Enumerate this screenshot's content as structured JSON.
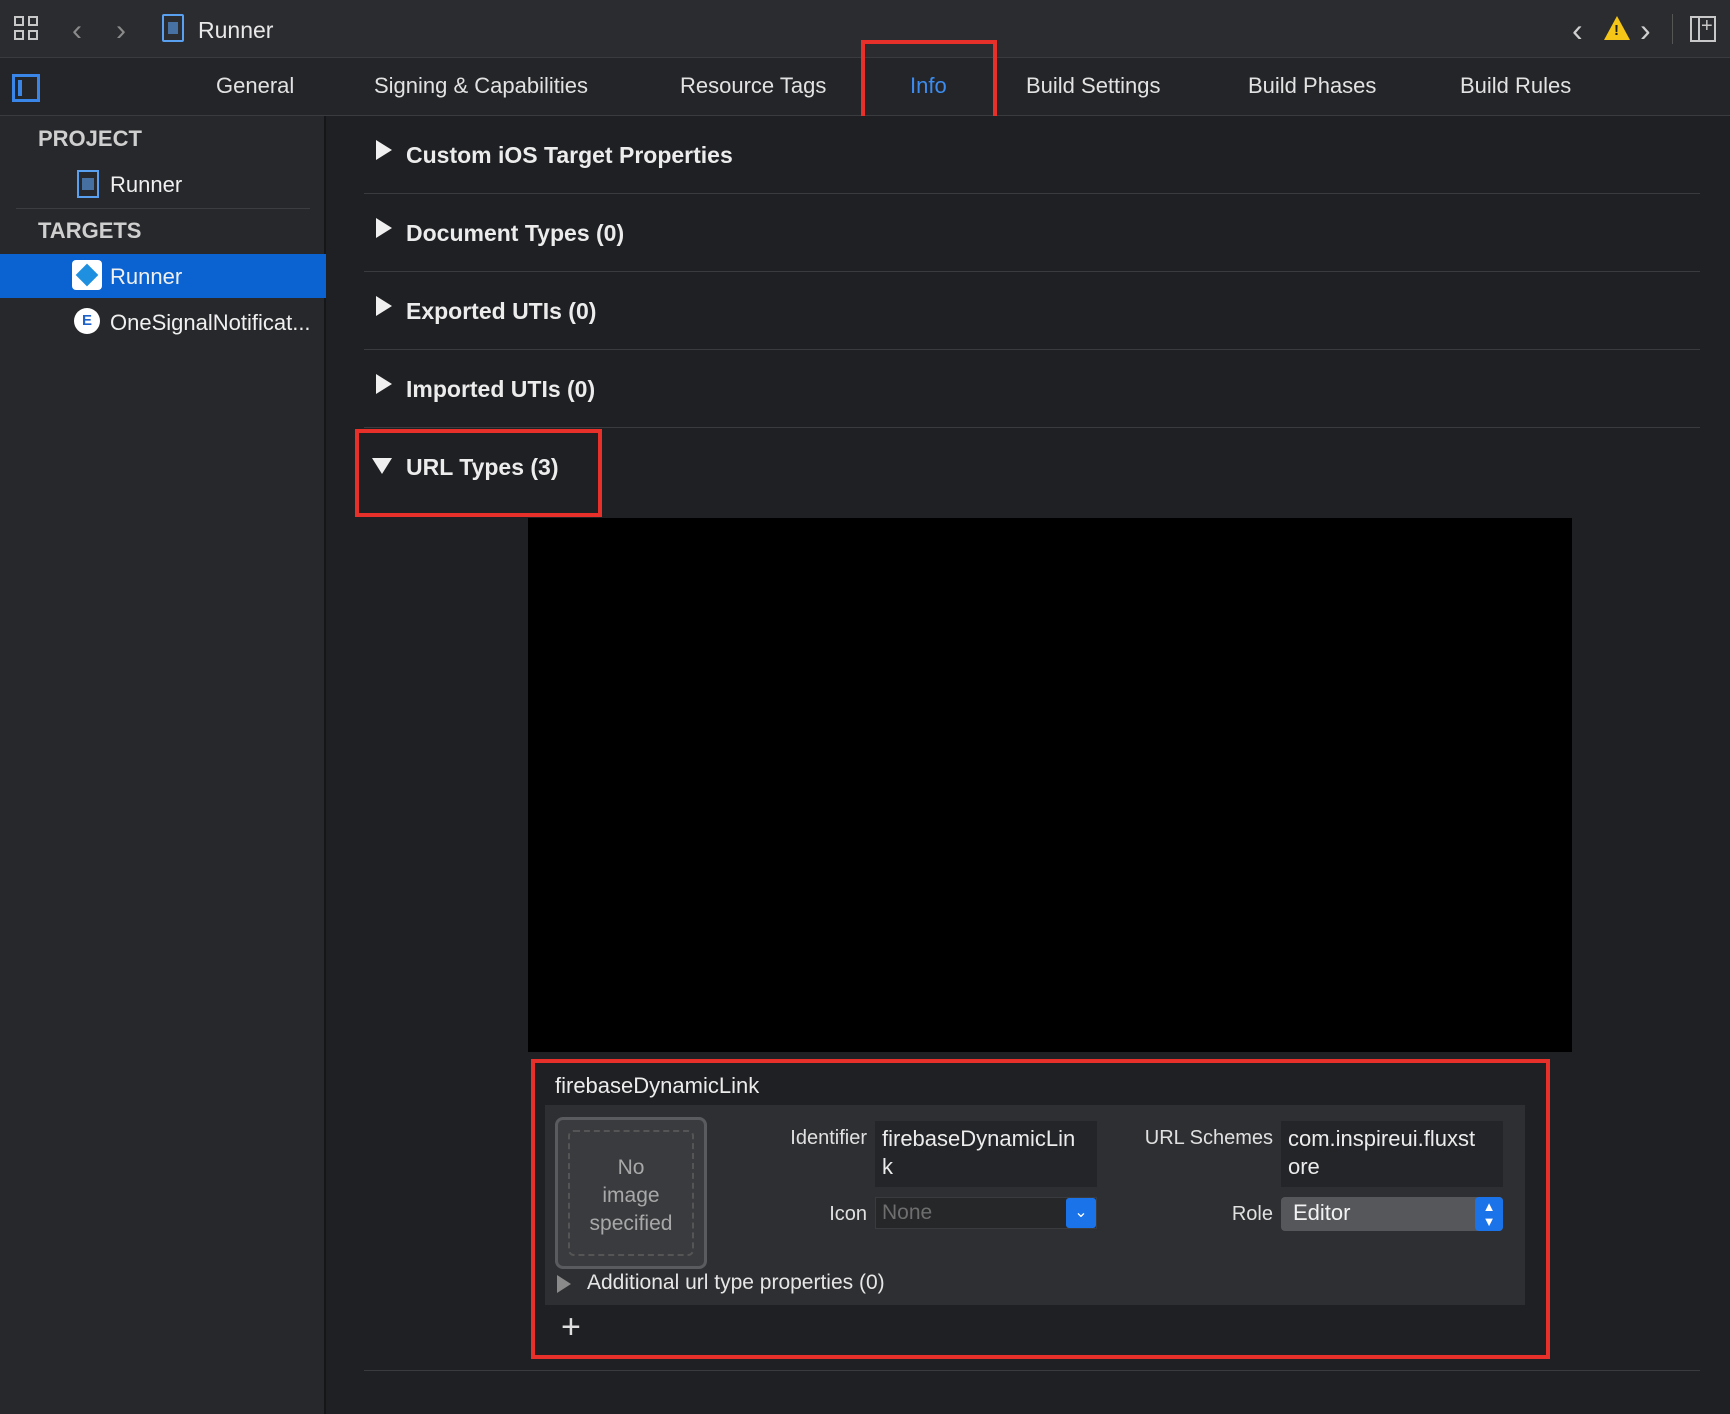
{
  "toolbar": {
    "title": "Runner",
    "icons": [
      "grid-icon",
      "back-arrow-icon",
      "forward-arrow-icon",
      "project-file-icon",
      "warning-prev-icon",
      "warning-icon",
      "warning-next-icon",
      "inspector-toggle-icon"
    ]
  },
  "tabs": {
    "general": "General",
    "signing": "Signing & Capabilities",
    "resource_tags": "Resource Tags",
    "info": "Info",
    "build_settings": "Build Settings",
    "build_phases": "Build Phases",
    "build_rules": "Build Rules",
    "active": "Info"
  },
  "sidebar": {
    "project_header": "PROJECT",
    "project_item": "Runner",
    "targets_header": "TARGETS",
    "targets": [
      {
        "label": "Runner",
        "selected": true
      },
      {
        "label": "OneSignalNotificat...",
        "selected": false
      }
    ]
  },
  "sections": [
    {
      "label": "Custom iOS Target Properties",
      "expanded": false
    },
    {
      "label": "Document Types (0)",
      "expanded": false
    },
    {
      "label": "Exported UTIs (0)",
      "expanded": false
    },
    {
      "label": "Imported UTIs (0)",
      "expanded": false
    },
    {
      "label": "URL Types (3)",
      "expanded": true
    }
  ],
  "url_type": {
    "name": "firebaseDynamicLink",
    "no_image_line1": "No",
    "no_image_line2": "image",
    "no_image_line3": "specified",
    "identifier_label": "Identifier",
    "identifier_value_line1": "firebaseDynamicLin",
    "identifier_value_line2": "k",
    "icon_label": "Icon",
    "icon_placeholder": "None",
    "url_schemes_label": "URL Schemes",
    "url_schemes_value_line1": "com.inspireui.fluxst",
    "url_schemes_value_line2": "ore",
    "role_label": "Role",
    "role_value": "Editor",
    "additional_label": "Additional url type properties (0)",
    "add_label": "+"
  },
  "colors": {
    "accent": "#3c8cf0",
    "selection": "#0b63d1",
    "highlight_box": "#e8302a",
    "warning": "#f5c518"
  }
}
